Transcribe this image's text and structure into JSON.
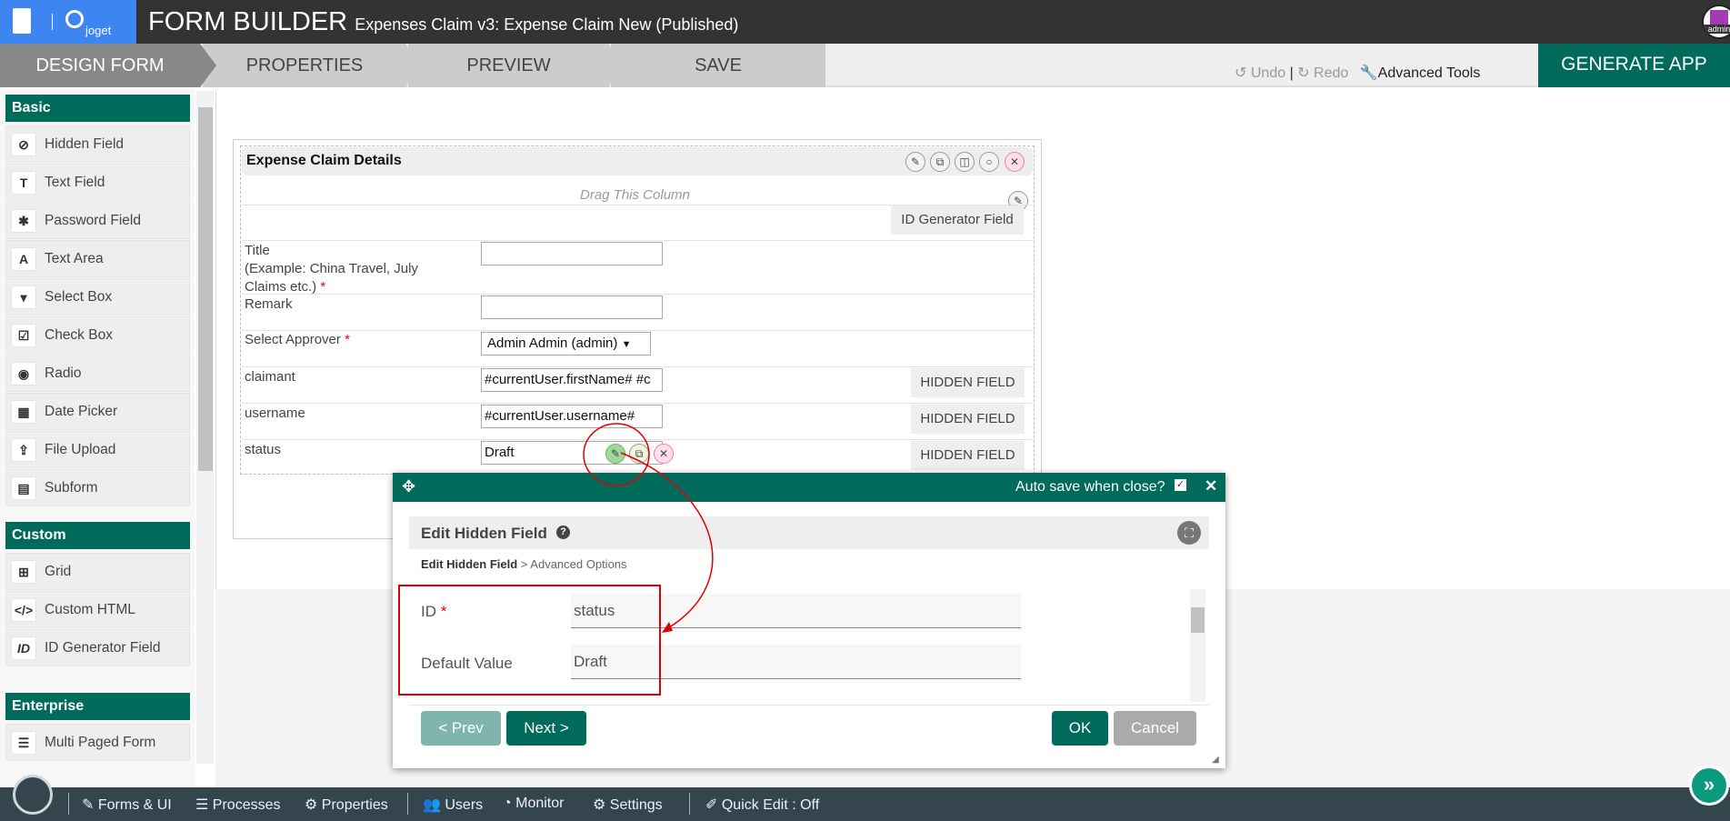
{
  "header": {
    "logo_text": "joget",
    "title": "FORM BUILDER",
    "subtitle": "Expenses Claim v3: Expense Claim New (Published)",
    "avatar_label": "admin"
  },
  "steps": [
    "DESIGN FORM",
    "PROPERTIES",
    "PREVIEW",
    "SAVE"
  ],
  "toolbar": {
    "undo": "Undo",
    "redo": "Redo",
    "separator": "|",
    "advanced": "Advanced Tools",
    "generate": "GENERATE APP"
  },
  "sidebar": {
    "categories": [
      {
        "label": "Basic",
        "items": [
          {
            "label": "Hidden Field",
            "icon": "eye-slash-icon"
          },
          {
            "label": "Text Field",
            "icon": "text-field-icon"
          },
          {
            "label": "Password Field",
            "icon": "asterisk-icon"
          },
          {
            "label": "Text Area",
            "icon": "text-area-icon"
          },
          {
            "label": "Select Box",
            "icon": "select-box-icon"
          },
          {
            "label": "Check Box",
            "icon": "checkbox-icon"
          },
          {
            "label": "Radio",
            "icon": "radio-icon"
          },
          {
            "label": "Date Picker",
            "icon": "calendar-icon"
          },
          {
            "label": "File Upload",
            "icon": "upload-icon"
          },
          {
            "label": "Subform",
            "icon": "subform-icon"
          }
        ]
      },
      {
        "label": "Custom",
        "items": [
          {
            "label": "Grid",
            "icon": "grid-icon"
          },
          {
            "label": "Custom HTML",
            "icon": "code-icon"
          },
          {
            "label": "ID Generator Field",
            "icon": "id-icon"
          }
        ]
      },
      {
        "label": "Enterprise",
        "items": [
          {
            "label": "Multi Paged Form",
            "icon": "multi-page-icon"
          }
        ]
      }
    ]
  },
  "form": {
    "section_title": "Expense Claim Details",
    "drag_text": "Drag This Column",
    "id_generator": "ID Generator Field",
    "fields": [
      {
        "label": "Title",
        "label2": "(Example: China Travel, July",
        "label3": "Claims etc.)",
        "required": "*",
        "value": ""
      },
      {
        "label": "Remark",
        "value": ""
      },
      {
        "label": "Select Approver",
        "required": "*",
        "value": "Admin Admin (admin)"
      },
      {
        "label": "claimant",
        "value": "#currentUser.firstName# #c",
        "tag": "HIDDEN FIELD"
      },
      {
        "label": "username",
        "value": "#currentUser.username#",
        "tag": "HIDDEN FIELD"
      },
      {
        "label": "status",
        "value": "Draft",
        "tag": "HIDDEN FIELD"
      }
    ]
  },
  "dialog": {
    "auto_save": "Auto save when close?",
    "title": "Edit Hidden Field",
    "breadcrumb_current": "Edit Hidden Field",
    "breadcrumb_sep": ">",
    "breadcrumb_next": "Advanced Options",
    "id_label": "ID",
    "id_required": "*",
    "id_value": "status",
    "default_label": "Default Value",
    "default_value": "Draft",
    "prev": "< Prev",
    "next": "Next >",
    "ok": "OK",
    "cancel": "Cancel"
  },
  "bottombar": {
    "forms": "Forms & UI",
    "processes": "Processes",
    "properties": "Properties",
    "users": "Users",
    "monitor": "Monitor",
    "settings": "Settings",
    "quick_edit": "Quick Edit : Off"
  },
  "colors": {
    "brand": "#006b5b",
    "logo_bg": "#3d85f0",
    "annotation": "#e00000"
  }
}
